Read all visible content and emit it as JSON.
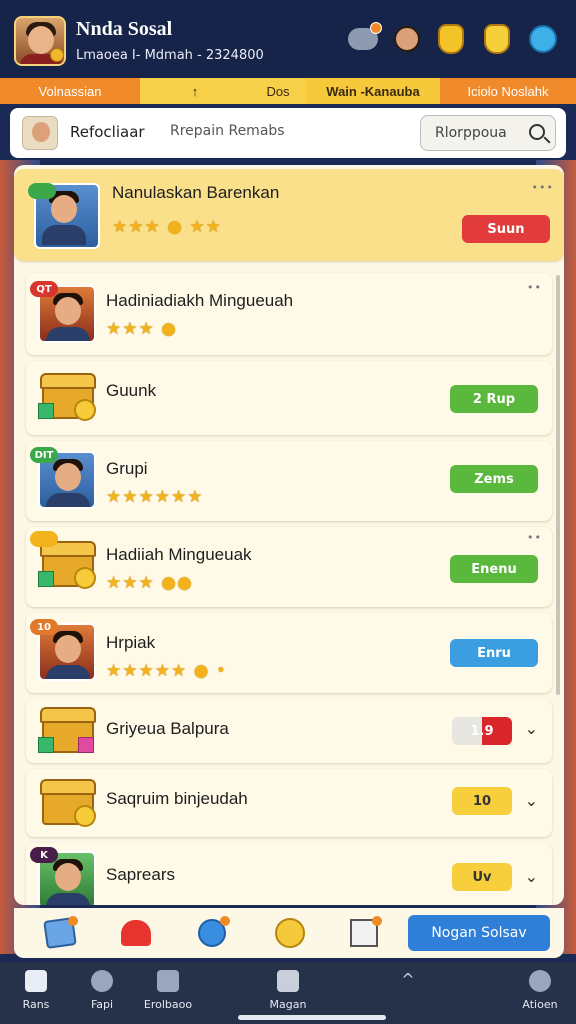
{
  "profile": {
    "name": "Nnda Sosal",
    "subtitle": "Lmaoea I- Mdmah - 2324800"
  },
  "tabs": [
    {
      "label": "Volnassian"
    },
    {
      "label": "↑"
    },
    {
      "label": "Dos"
    },
    {
      "label": "Wain -Kanauba"
    },
    {
      "label": "Iciolo Noslahk"
    }
  ],
  "search": {
    "label": "Refocliaar",
    "hint": "Rrepain Remabs",
    "box_text": "Rlorppoua"
  },
  "items": [
    {
      "tag": "",
      "title": "Nanulaskan Barenkan",
      "stars": "★★★ ● ★★",
      "button": "Suun"
    },
    {
      "tag": "QT",
      "title": "Hadiniadiakh Mingueuah",
      "stars": "★★★ ●",
      "button": ""
    },
    {
      "tag": "",
      "title": "Guunk",
      "stars": "",
      "button": "2 Rup"
    },
    {
      "tag": "DIT",
      "title": "Grupi",
      "stars": "★★★★★★",
      "button": "Zems"
    },
    {
      "tag": "",
      "title": "Hadiiah Mingueuak",
      "stars": "★★★ ●●",
      "button": "Enenu"
    },
    {
      "tag": "10",
      "title": "Hrpiak",
      "stars": "★★★★★ ● •",
      "button": "Enru"
    },
    {
      "tag": "",
      "title": "Griyeua Balpura",
      "stars": "",
      "button": "1.9"
    },
    {
      "tag": "",
      "title": "Saqruim binjeudah",
      "stars": "",
      "button": "10"
    },
    {
      "tag": "K",
      "title": "Saprears",
      "stars": "",
      "button": "Uv"
    }
  ],
  "cta": "Nogan Solsav",
  "nav": [
    {
      "label": "Rans"
    },
    {
      "label": "Fapi"
    },
    {
      "label": "Erolbaoo"
    },
    {
      "label": "Magan"
    },
    {
      "label": ""
    },
    {
      "label": "Atioen"
    }
  ],
  "colors": {
    "header_bg": "#17244a",
    "tab_orange": "#f08a2a",
    "tab_yellow": "#f7d04a",
    "panel": "#fdf7e6",
    "cta_blue": "#2f7fd8"
  }
}
